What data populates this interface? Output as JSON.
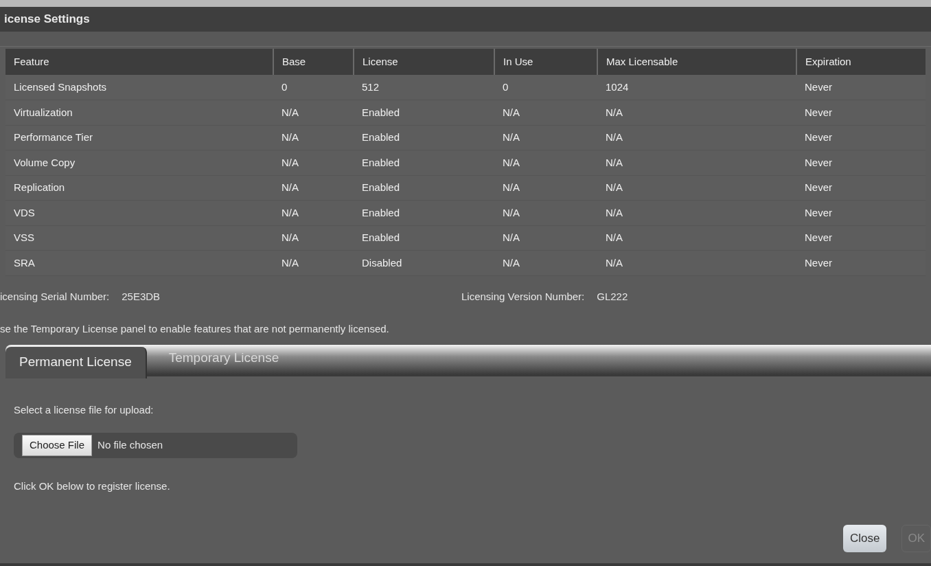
{
  "window": {
    "title": "icense Settings"
  },
  "table": {
    "columns": [
      "Feature",
      "Base",
      "License",
      "In Use",
      "Max Licensable",
      "Expiration"
    ],
    "rows": [
      [
        "Licensed Snapshots",
        "0",
        "512",
        "0",
        "1024",
        "Never"
      ],
      [
        "Virtualization",
        "N/A",
        "Enabled",
        "N/A",
        "N/A",
        "Never"
      ],
      [
        "Performance Tier",
        "N/A",
        "Enabled",
        "N/A",
        "N/A",
        "Never"
      ],
      [
        "Volume Copy",
        "N/A",
        "Enabled",
        "N/A",
        "N/A",
        "Never"
      ],
      [
        "Replication",
        "N/A",
        "Enabled",
        "N/A",
        "N/A",
        "Never"
      ],
      [
        "VDS",
        "N/A",
        "Enabled",
        "N/A",
        "N/A",
        "Never"
      ],
      [
        "VSS",
        "N/A",
        "Enabled",
        "N/A",
        "N/A",
        "Never"
      ],
      [
        "SRA",
        "N/A",
        "Disabled",
        "N/A",
        "N/A",
        "Never"
      ]
    ]
  },
  "serial": {
    "label": "icensing Serial Number:",
    "value": "25E3DB"
  },
  "version": {
    "label": "Licensing Version Number:",
    "value": "GL222"
  },
  "note": "se the Temporary License panel to enable features that are not permanently licensed.",
  "tabs": [
    {
      "label": "Permanent License",
      "selected": true
    },
    {
      "label": "Temporary License",
      "selected": false
    }
  ],
  "upload_prompt": "Select a license file for upload:",
  "file_input": {
    "button": "Choose File",
    "value": "No file chosen"
  },
  "register_hint": "Click OK below to register license.",
  "buttons": [
    {
      "label": "Close",
      "disabled": false
    },
    {
      "label": "OK",
      "disabled": true
    }
  ]
}
